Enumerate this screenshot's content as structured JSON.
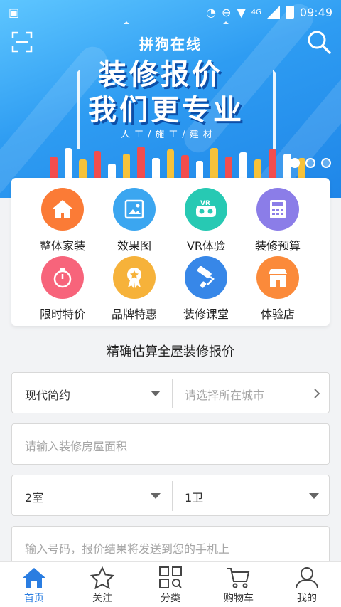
{
  "status_bar": {
    "time": "09:49",
    "network": "4G"
  },
  "banner": {
    "brand": "拼狗在线",
    "title_line1": "装修报价",
    "title_line2": "我们更专业",
    "subtitle": "人工/施工/建材",
    "slide_count": 3,
    "active_slide": 0
  },
  "categories": [
    {
      "label": "整体家装",
      "icon": "home-icon",
      "color": "#fb7b36"
    },
    {
      "label": "效果图",
      "icon": "picture-icon",
      "color": "#3ba6f0"
    },
    {
      "label": "VR体验",
      "icon": "vr-icon",
      "color": "#27c9b3"
    },
    {
      "label": "装修预算",
      "icon": "calculator-icon",
      "color": "#8b7de8"
    },
    {
      "label": "限时特价",
      "icon": "stopwatch-icon",
      "color": "#f7647b"
    },
    {
      "label": "品牌特惠",
      "icon": "medal-icon",
      "color": "#f6b23a"
    },
    {
      "label": "装修课堂",
      "icon": "paint-roller-icon",
      "color": "#3787e8"
    },
    {
      "label": "体验店",
      "icon": "store-icon",
      "color": "#fb8a3a"
    }
  ],
  "form": {
    "title": "精确估算全屋装修报价",
    "style_value": "现代简约",
    "city_placeholder": "请选择所在城市",
    "area_placeholder": "请输入装修房屋面积",
    "rooms_value": "2室",
    "baths_value": "1卫",
    "phone_placeholder": "输入号码，报价结果将发送到您的手机上"
  },
  "tabbar": [
    {
      "label": "首页",
      "icon": "home-tab-icon",
      "active": true
    },
    {
      "label": "关注",
      "icon": "star-icon",
      "active": false
    },
    {
      "label": "分类",
      "icon": "category-grid-icon",
      "active": false
    },
    {
      "label": "购物车",
      "icon": "cart-icon",
      "active": false
    },
    {
      "label": "我的",
      "icon": "user-icon",
      "active": false
    }
  ],
  "colors": {
    "accent": "#2a7de1",
    "banner": "#2e9cf2"
  }
}
